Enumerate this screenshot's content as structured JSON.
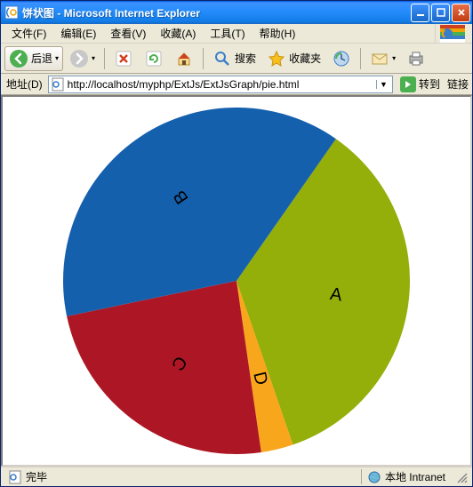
{
  "window": {
    "title": "饼状图 - Microsoft Internet Explorer"
  },
  "menu": {
    "file": "文件(F)",
    "edit": "编辑(E)",
    "view": "查看(V)",
    "favorites": "收藏(A)",
    "tools": "工具(T)",
    "help": "帮助(H)"
  },
  "toolbar": {
    "back": "后退",
    "search": "搜索",
    "favorites": "收藏夹"
  },
  "addressbar": {
    "label": "地址(D)",
    "url": "http://localhost/myphp/ExtJs/ExtJsGraph/pie.html",
    "go": "转到",
    "links": "链接"
  },
  "status": {
    "done": "完毕",
    "zone": "本地 Intranet"
  },
  "chart_data": {
    "type": "pie",
    "title": "",
    "slices": [
      {
        "label": "A",
        "value": 35,
        "color": "#94ae0a"
      },
      {
        "label": "D",
        "value": 3,
        "color": "#f8a61b"
      },
      {
        "label": "C",
        "value": 24,
        "color": "#ad1725"
      },
      {
        "label": "B",
        "value": 38,
        "color": "#1560ad"
      }
    ],
    "start_angle_deg": -55
  }
}
